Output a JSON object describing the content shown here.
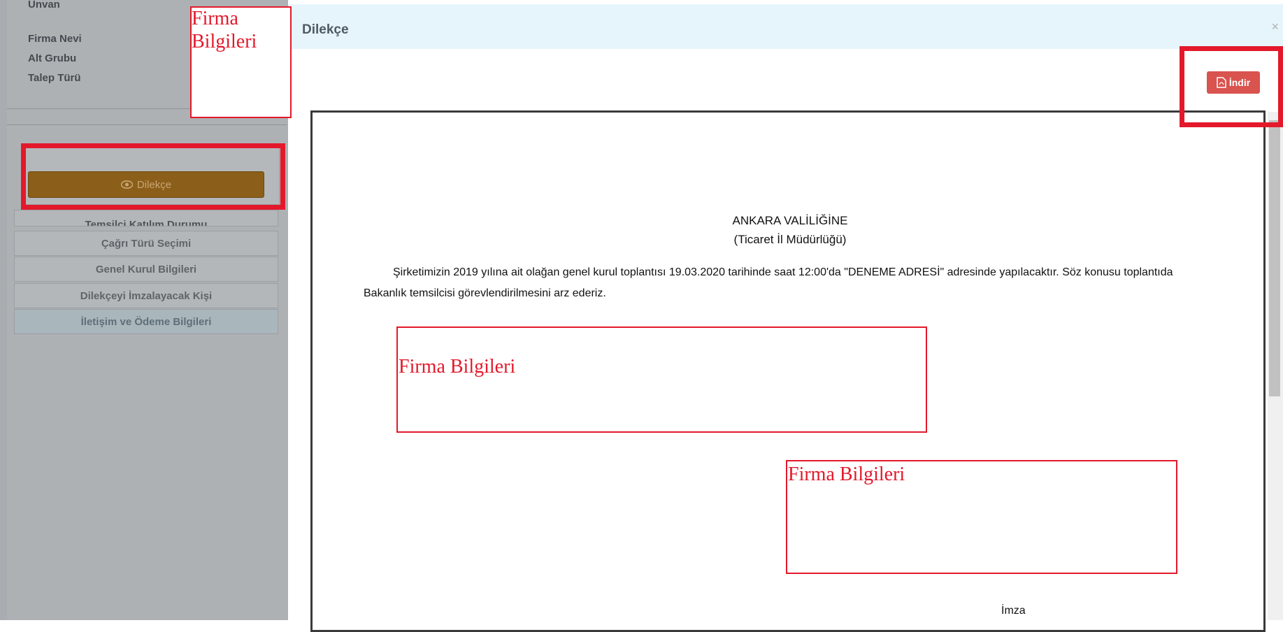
{
  "sidebar": {
    "info_labels": [
      "Ünvan",
      "Firma Nevi",
      "Alt Grubu",
      "Talep Türü"
    ],
    "dilekce_button": "Dilekçe",
    "menu_items": [
      "Temsilci Katılım Durumu",
      "Çağrı Türü Seçimi",
      "Genel Kurul Bilgileri",
      "Dilekçeyi İmzalayacak Kişi",
      "İletişim ve Ödeme Bilgileri"
    ]
  },
  "modal": {
    "title": "Dilekçe",
    "close": "×",
    "download_label": "İndir",
    "document": {
      "heading_line1": "ANKARA VALİLİĞİNE",
      "heading_line2": "(Ticaret İl Müdürlüğü)",
      "body": "Şirketimizin 2019 yılına ait olağan genel kurul toplantısı 19.03.2020 tarihinde saat 12:00'da \"DENEME ADRESİ\" adresinde yapılacaktır. Söz konusu toplantıda Bakanlık temsilcisi görevlendirilmesini arz ederiz.",
      "signature_label": "İmza"
    }
  },
  "annotations": {
    "top_label": "Firma Bilgileri",
    "mid_label": "Firma Bilgileri",
    "bottom_label": "Firma Bilgileri",
    "highlight_color": "#e3192b"
  },
  "icons": {
    "dilekce_icon": "eye-icon",
    "download_icon": "pdf-file-icon"
  }
}
